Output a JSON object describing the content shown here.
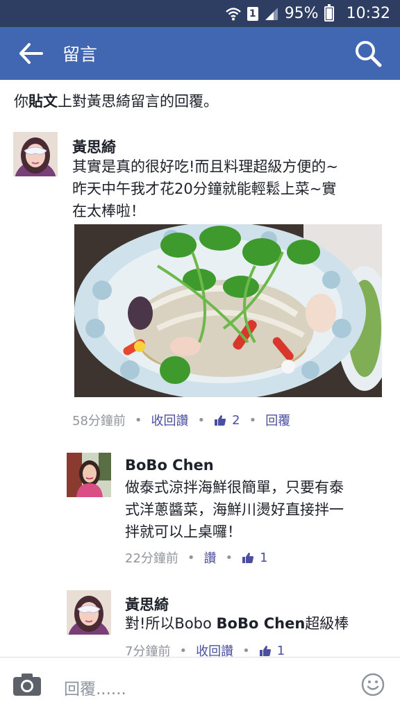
{
  "status_bar": {
    "battery": "95%",
    "time": "10:32",
    "sim": "1"
  },
  "header": {
    "title": "留言"
  },
  "notice": {
    "prefix": "你",
    "bold": "貼文",
    "suffix": "上對黃思綺留言的回覆。"
  },
  "comments": [
    {
      "author": "黃思綺",
      "lines": [
        "其實是真的很好吃!而且料理超級方便的~",
        "昨天中午我才花20分鐘就能輕鬆上菜~實",
        "在太棒啦！"
      ],
      "time": "58分鐘前",
      "action": "收回讚",
      "likes": "2",
      "reply": "回覆"
    },
    {
      "author": "BoBo Chen",
      "lines": [
        "做泰式涼拌海鮮很簡單，只要有泰",
        "式洋蔥醬菜，海鮮川燙好直接拌一",
        "拌就可以上桌囉！"
      ],
      "time": "22分鐘前",
      "action": "讚",
      "likes": "1"
    },
    {
      "author": "黃思綺",
      "text_prefix": "對!所以Bobo ",
      "mention": "BoBo Chen",
      "text_suffix": "超級棒",
      "time": "7分鐘前",
      "action": "收回讚",
      "likes": "1"
    }
  ],
  "reply_bar": {
    "placeholder": "回覆......"
  },
  "icons": {
    "back": "arrow-left-icon",
    "search": "search-icon",
    "camera": "camera-icon",
    "emoji": "smiley-icon",
    "thumb": "thumbs-up-icon"
  },
  "colors": {
    "status_bar": "#2d3e62",
    "header": "#4267b2",
    "link": "#4b4f9f",
    "meta": "#90949c"
  }
}
